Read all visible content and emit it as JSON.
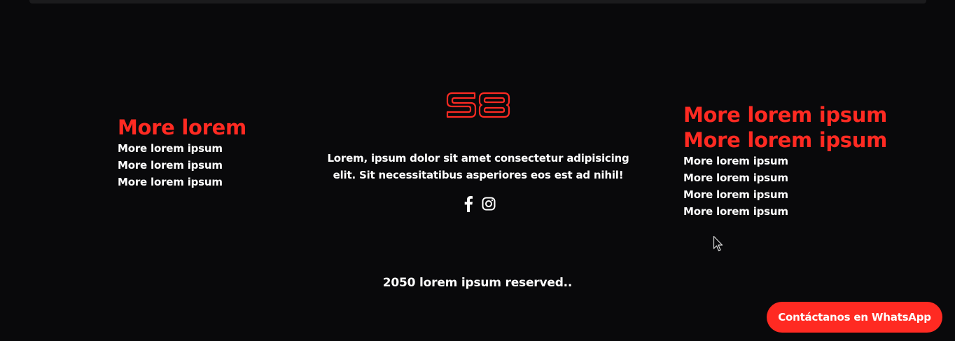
{
  "footer": {
    "left_column": {
      "heading": "More lorem",
      "links": [
        "More lorem ipsum",
        "More lorem ipsum",
        "More lorem ipsum"
      ]
    },
    "center_column": {
      "logo_text": "S8",
      "tagline": "Lorem, ipsum dolor sit amet consectetur adipisicing elit. Sit necessitatibus asperiores eos est ad nihil!",
      "social_icons": [
        "facebook-icon",
        "instagram-icon"
      ]
    },
    "right_column": {
      "heading_line_1": "More lorem ipsum",
      "heading_line_2": "More lorem ipsum",
      "links": [
        "More lorem ipsum",
        "More lorem ipsum",
        "More lorem ipsum",
        "More lorem ipsum"
      ]
    },
    "copyright": "2050 lorem ipsum reserved.."
  },
  "whatsapp_button": {
    "label": "Contáctanos en WhatsApp"
  },
  "colors": {
    "background": "#09090b",
    "accent": "#ff2a22",
    "text": "#ffffff",
    "top_bar": "#1b1b1d"
  }
}
